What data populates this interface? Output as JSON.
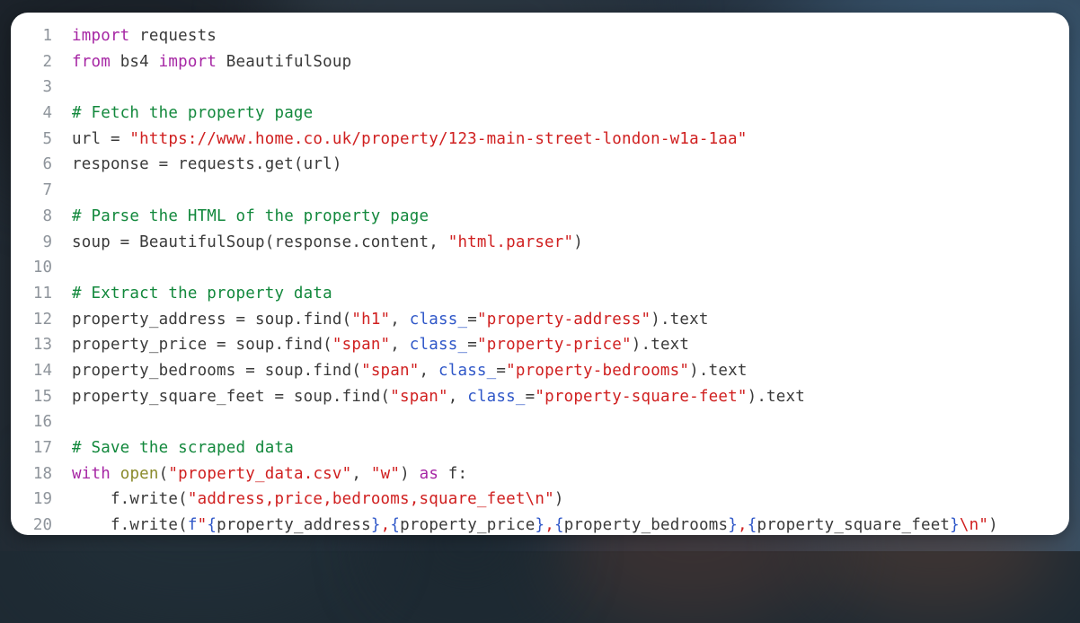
{
  "window": {
    "title": "Python code snippet",
    "background_colors": {
      "backdrop_dark": "#27313a",
      "backdrop_blue": "#3f6280",
      "backdrop_warm": "#6b4434",
      "card": "#ffffff"
    }
  },
  "editor": {
    "language": "python",
    "line_count": 20,
    "gutter_visible": true,
    "theme_colors": {
      "keyword": "#a626a4",
      "string": "#d02020",
      "comment": "#12883c",
      "keyword_argument": "#2f57c8",
      "builtin": "#8a8a2b",
      "plain_text": "#3a3a3a",
      "line_number": "#8e949b"
    },
    "lines": [
      {
        "number": "1",
        "tokens": [
          {
            "t": "import",
            "c": "kw"
          },
          {
            "t": " requests",
            "c": "txt"
          }
        ]
      },
      {
        "number": "2",
        "tokens": [
          {
            "t": "from",
            "c": "kw"
          },
          {
            "t": " bs4 ",
            "c": "txt"
          },
          {
            "t": "import",
            "c": "kw"
          },
          {
            "t": " BeautifulSoup",
            "c": "txt"
          }
        ]
      },
      {
        "number": "3",
        "tokens": []
      },
      {
        "number": "4",
        "tokens": [
          {
            "t": "# Fetch the property page",
            "c": "com"
          }
        ]
      },
      {
        "number": "5",
        "tokens": [
          {
            "t": "url = ",
            "c": "txt"
          },
          {
            "t": "\"https://www.home.co.uk/property/123-main-street-london-w1a-1aa\"",
            "c": "str"
          }
        ]
      },
      {
        "number": "6",
        "tokens": [
          {
            "t": "response = requests.get(url)",
            "c": "txt"
          }
        ]
      },
      {
        "number": "7",
        "tokens": []
      },
      {
        "number": "8",
        "tokens": [
          {
            "t": "# Parse the HTML of the property page",
            "c": "com"
          }
        ]
      },
      {
        "number": "9",
        "tokens": [
          {
            "t": "soup = BeautifulSoup(response.content, ",
            "c": "txt"
          },
          {
            "t": "\"html.parser\"",
            "c": "str"
          },
          {
            "t": ")",
            "c": "txt"
          }
        ]
      },
      {
        "number": "10",
        "tokens": []
      },
      {
        "number": "11",
        "tokens": [
          {
            "t": "# Extract the property data",
            "c": "com"
          }
        ]
      },
      {
        "number": "12",
        "tokens": [
          {
            "t": "property_address = soup.find(",
            "c": "txt"
          },
          {
            "t": "\"h1\"",
            "c": "str"
          },
          {
            "t": ", ",
            "c": "txt"
          },
          {
            "t": "class_",
            "c": "kwarg"
          },
          {
            "t": "=",
            "c": "txt"
          },
          {
            "t": "\"property-address\"",
            "c": "str"
          },
          {
            "t": ").text",
            "c": "txt"
          }
        ]
      },
      {
        "number": "13",
        "tokens": [
          {
            "t": "property_price = soup.find(",
            "c": "txt"
          },
          {
            "t": "\"span\"",
            "c": "str"
          },
          {
            "t": ", ",
            "c": "txt"
          },
          {
            "t": "class_",
            "c": "kwarg"
          },
          {
            "t": "=",
            "c": "txt"
          },
          {
            "t": "\"property-price\"",
            "c": "str"
          },
          {
            "t": ").text",
            "c": "txt"
          }
        ]
      },
      {
        "number": "14",
        "tokens": [
          {
            "t": "property_bedrooms = soup.find(",
            "c": "txt"
          },
          {
            "t": "\"span\"",
            "c": "str"
          },
          {
            "t": ", ",
            "c": "txt"
          },
          {
            "t": "class_",
            "c": "kwarg"
          },
          {
            "t": "=",
            "c": "txt"
          },
          {
            "t": "\"property-bedrooms\"",
            "c": "str"
          },
          {
            "t": ").text",
            "c": "txt"
          }
        ]
      },
      {
        "number": "15",
        "tokens": [
          {
            "t": "property_square_feet = soup.find(",
            "c": "txt"
          },
          {
            "t": "\"span\"",
            "c": "str"
          },
          {
            "t": ", ",
            "c": "txt"
          },
          {
            "t": "class_",
            "c": "kwarg"
          },
          {
            "t": "=",
            "c": "txt"
          },
          {
            "t": "\"property-square-feet\"",
            "c": "str"
          },
          {
            "t": ").text",
            "c": "txt"
          }
        ]
      },
      {
        "number": "16",
        "tokens": []
      },
      {
        "number": "17",
        "tokens": [
          {
            "t": "# Save the scraped data",
            "c": "com"
          }
        ]
      },
      {
        "number": "18",
        "tokens": [
          {
            "t": "with",
            "c": "kw"
          },
          {
            "t": " ",
            "c": "txt"
          },
          {
            "t": "open",
            "c": "bi"
          },
          {
            "t": "(",
            "c": "txt"
          },
          {
            "t": "\"property_data.csv\"",
            "c": "str"
          },
          {
            "t": ", ",
            "c": "txt"
          },
          {
            "t": "\"w\"",
            "c": "str"
          },
          {
            "t": ") ",
            "c": "txt"
          },
          {
            "t": "as",
            "c": "kw"
          },
          {
            "t": " f:",
            "c": "txt"
          }
        ]
      },
      {
        "number": "19",
        "tokens": [
          {
            "t": "    f.write(",
            "c": "txt"
          },
          {
            "t": "\"address,price,bedrooms,square_feet\\n\"",
            "c": "str"
          },
          {
            "t": ")",
            "c": "txt"
          }
        ]
      },
      {
        "number": "20",
        "tokens": [
          {
            "t": "    f.write(",
            "c": "txt"
          },
          {
            "t": "f",
            "c": "kwarg"
          },
          {
            "t": "\"",
            "c": "str"
          },
          {
            "t": "{",
            "c": "kwarg"
          },
          {
            "t": "property_address",
            "c": "txt"
          },
          {
            "t": "}",
            "c": "kwarg"
          },
          {
            "t": ",",
            "c": "str"
          },
          {
            "t": "{",
            "c": "kwarg"
          },
          {
            "t": "property_price",
            "c": "txt"
          },
          {
            "t": "}",
            "c": "kwarg"
          },
          {
            "t": ",",
            "c": "str"
          },
          {
            "t": "{",
            "c": "kwarg"
          },
          {
            "t": "property_bedrooms",
            "c": "txt"
          },
          {
            "t": "}",
            "c": "kwarg"
          },
          {
            "t": ",",
            "c": "str"
          },
          {
            "t": "{",
            "c": "kwarg"
          },
          {
            "t": "property_square_feet",
            "c": "txt"
          },
          {
            "t": "}",
            "c": "kwarg"
          },
          {
            "t": "\\n",
            "c": "esc"
          },
          {
            "t": "\"",
            "c": "str"
          },
          {
            "t": ")",
            "c": "txt"
          }
        ]
      }
    ]
  }
}
